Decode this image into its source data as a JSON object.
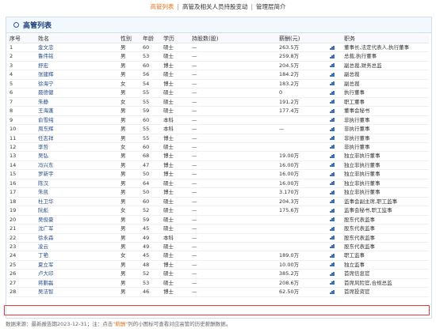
{
  "nav": {
    "tab_executives": "高管列表",
    "tab_holdings": "高管及相关人员持股变动",
    "tab_profile": "管理层简介"
  },
  "panel": {
    "title": "高管列表"
  },
  "table": {
    "headers": [
      "序号",
      "姓名",
      "性别",
      "年龄",
      "学历",
      "持股数(股)",
      "薪酬(元)",
      "职务"
    ],
    "rows": [
      [
        "1",
        "金文忠",
        "男",
        "60",
        "硕士",
        "—",
        "263.5万",
        "董事长,法定代表人,执行董事"
      ],
      [
        "2",
        "鲁伟铭",
        "男",
        "53",
        "硕士",
        "—",
        "259.8万",
        "总裁,执行董事"
      ],
      [
        "3",
        "舒宏",
        "男",
        "60",
        "博士",
        "—",
        "204.5万",
        "副总裁,财务总监"
      ],
      [
        "4",
        "张建辉",
        "男",
        "56",
        "硕士",
        "—",
        "184.2万",
        "副总裁"
      ],
      [
        "5",
        "徐海宁",
        "女",
        "54",
        "博士",
        "—",
        "183.2万",
        "副总裁"
      ],
      [
        "6",
        "聂德健",
        "男",
        "55",
        "硕士",
        "—",
        "0",
        "执行董事"
      ],
      [
        "7",
        "朱静",
        "女",
        "55",
        "硕士",
        "—",
        "191.2万",
        "职工董事"
      ],
      [
        "8",
        "王海蓬",
        "男",
        "59",
        "硕士",
        "—",
        "177.4万",
        "董事会秘书"
      ],
      [
        "9",
        "俞雪纯",
        "男",
        "60",
        "本科",
        "—",
        "",
        "非执行董事"
      ],
      [
        "10",
        "周东辉",
        "男",
        "55",
        "本科",
        "—",
        "—",
        "非执行董事"
      ],
      [
        "11",
        "任志祥",
        "男",
        "55",
        "博士",
        "—",
        "",
        "非执行董事"
      ],
      [
        "12",
        "李哲",
        "女",
        "60",
        "硕士",
        "—",
        "",
        "非执行董事"
      ],
      [
        "13",
        "吴弘",
        "男",
        "68",
        "博士",
        "—",
        "19.00万",
        "独立非执行董事"
      ],
      [
        "14",
        "冯兴东",
        "男",
        "47",
        "博士",
        "—",
        "16.00万",
        "独立非执行董事"
      ],
      [
        "15",
        "罗新宇",
        "男",
        "50",
        "博士",
        "—",
        "16.00万",
        "独立非执行董事"
      ],
      [
        "16",
        "陈汉",
        "男",
        "64",
        "硕士",
        "—",
        "16.00万",
        "独立非执行董事"
      ],
      [
        "17",
        "朱凯",
        "男",
        "50",
        "博士",
        "—",
        "3.170万",
        "独立非执行董事"
      ],
      [
        "18",
        "杜卫华",
        "男",
        "60",
        "硕士",
        "—",
        "204.3万",
        "监事会副主席,职工监事"
      ],
      [
        "19",
        "阮彪",
        "女",
        "52",
        "硕士",
        "—",
        "175.6万",
        "监事会秘书,职工监事"
      ],
      [
        "20",
        "吴俊豪",
        "男",
        "59",
        "硕士",
        "—",
        "",
        "股东代表监事"
      ],
      [
        "21",
        "沈广军",
        "男",
        "45",
        "硕士",
        "—",
        "",
        "股东代表监事"
      ],
      [
        "22",
        "徐永森",
        "男",
        "49",
        "本科",
        "—",
        "",
        "股东代表监事"
      ],
      [
        "23",
        "凌云",
        "男",
        "49",
        "硕士",
        "—",
        "",
        "股东代表监事"
      ],
      [
        "24",
        "丁艳",
        "女",
        "45",
        "硕士",
        "—",
        "189.0万",
        "职工监事"
      ],
      [
        "25",
        "夏立军",
        "男",
        "48",
        "博士",
        "—",
        "10.00万",
        "独立监事"
      ],
      [
        "26",
        "卢大印",
        "男",
        "52",
        "硕士",
        "—",
        "385.2万",
        "首席信息官"
      ],
      [
        "27",
        "蒋鹏磊",
        "男",
        "53",
        "硕士",
        "—",
        "208.6万",
        "首席风险官,合规总监"
      ],
      [
        "28",
        "吴洁智",
        "男",
        "46",
        "博士",
        "—",
        "62.50万",
        "首席投资官"
      ]
    ]
  },
  "footer": {
    "source_prefix": "数据来源：最新报告期2023-12-31；注：点击",
    "link_text": "\"薪酬\"",
    "source_suffix": "列的小图标可查看对应高管的历史薪酬数据。"
  },
  "colors": {
    "accent_orange": "#e8731a",
    "link_blue": "#2a4f8f",
    "highlight_red": "#e23a3a",
    "header_blue": "#1d3f78"
  }
}
